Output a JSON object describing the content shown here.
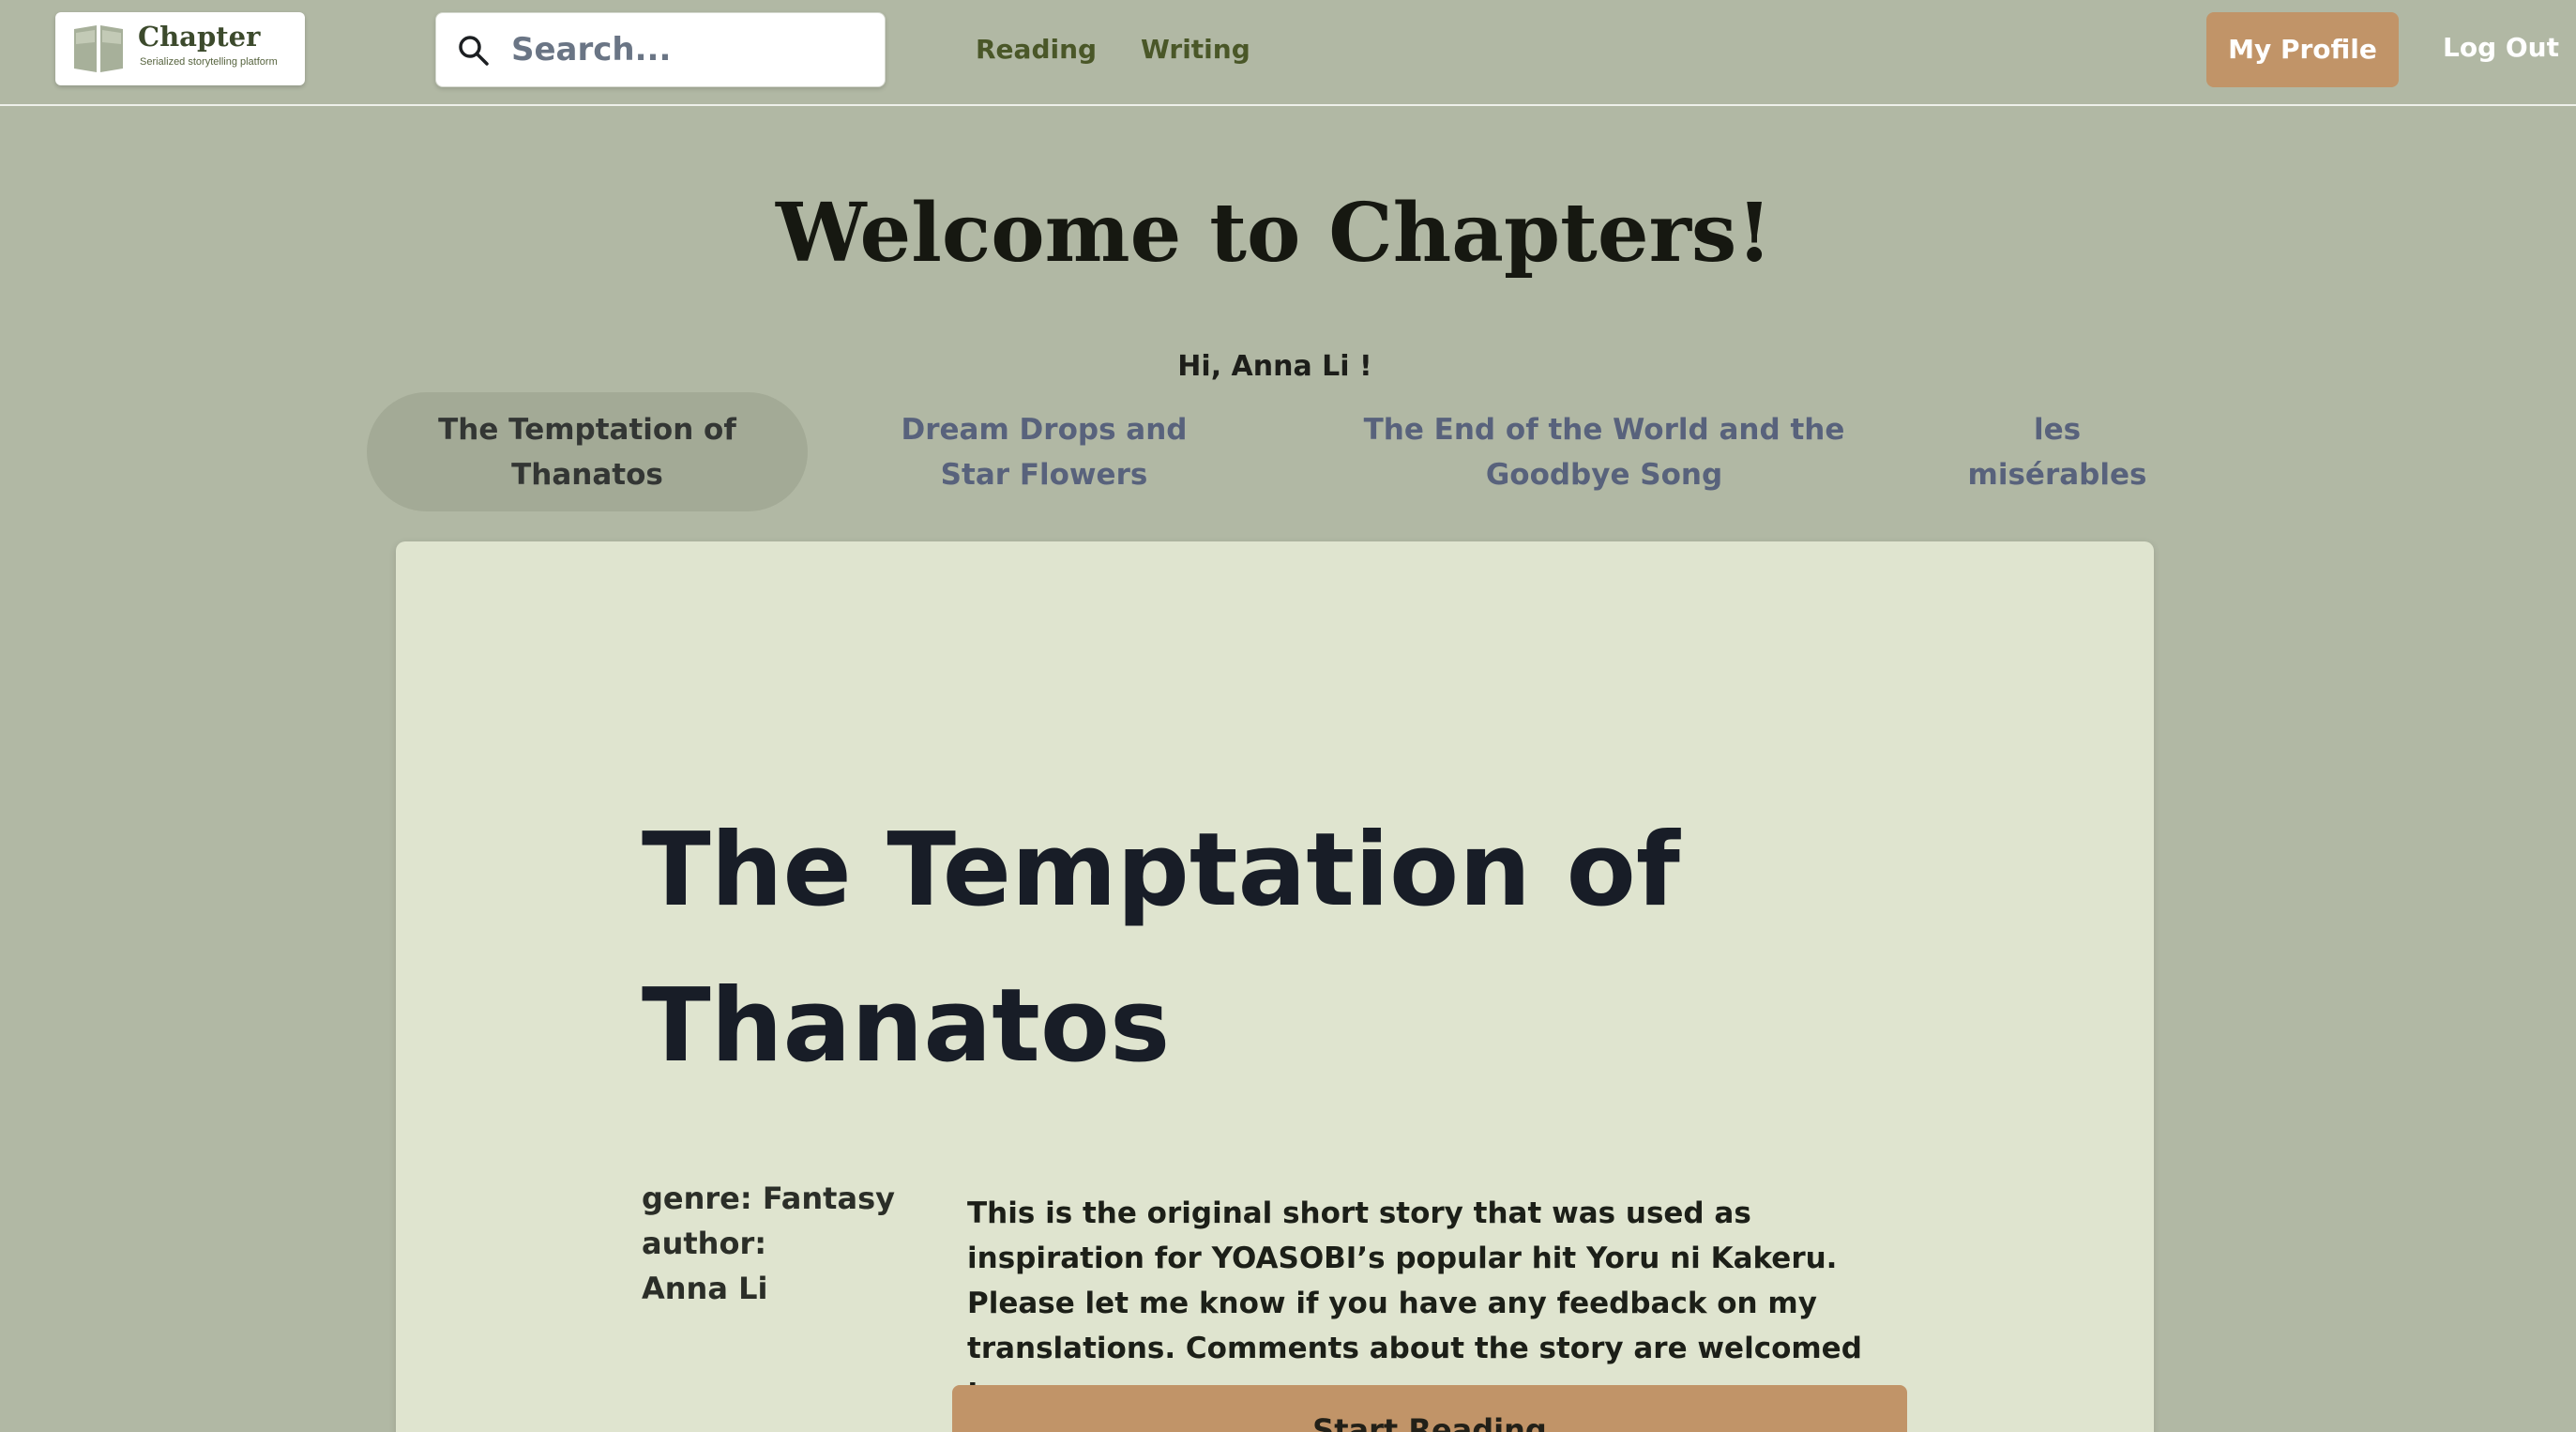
{
  "header": {
    "logo": {
      "name": "Chapter",
      "tagline": "Serialized storytelling platform",
      "icon": "open-book-icon"
    },
    "search": {
      "placeholder": "Search...",
      "value": "",
      "icon": "search-icon"
    },
    "nav": [
      {
        "label": "Reading"
      },
      {
        "label": "Writing"
      }
    ],
    "profile_label": "My Profile",
    "logout_label": "Log Out"
  },
  "welcome": {
    "title": "Welcome to Chapters!",
    "greeting": "Hi, Anna Li !"
  },
  "tabs": [
    {
      "label": "The Temptation of Thanatos",
      "active": true
    },
    {
      "label": "Dream Drops and Star Flowers",
      "active": false
    },
    {
      "label": "The End of the World and the Goodbye Song",
      "active": false
    },
    {
      "label": "les misérables",
      "active": false
    }
  ],
  "story": {
    "title": "The Temptation of Thanatos",
    "genre": "genre: Fantasy",
    "author_label": "author:",
    "author": "Anna Li",
    "description": "This is the original short story that was used as inspiration for YOASOBI’s popular hit Yoru ni Kakeru. Please let me know if you have any feedback on my translations. Comments about the story are welcomed too.",
    "start_label": "Start Reading"
  },
  "colors": {
    "background": "#b1b8a4",
    "card": "#dfe4cf",
    "accent": "#c19468",
    "nav_text": "#4a5728",
    "tab_inactive_text": "#58627c"
  }
}
